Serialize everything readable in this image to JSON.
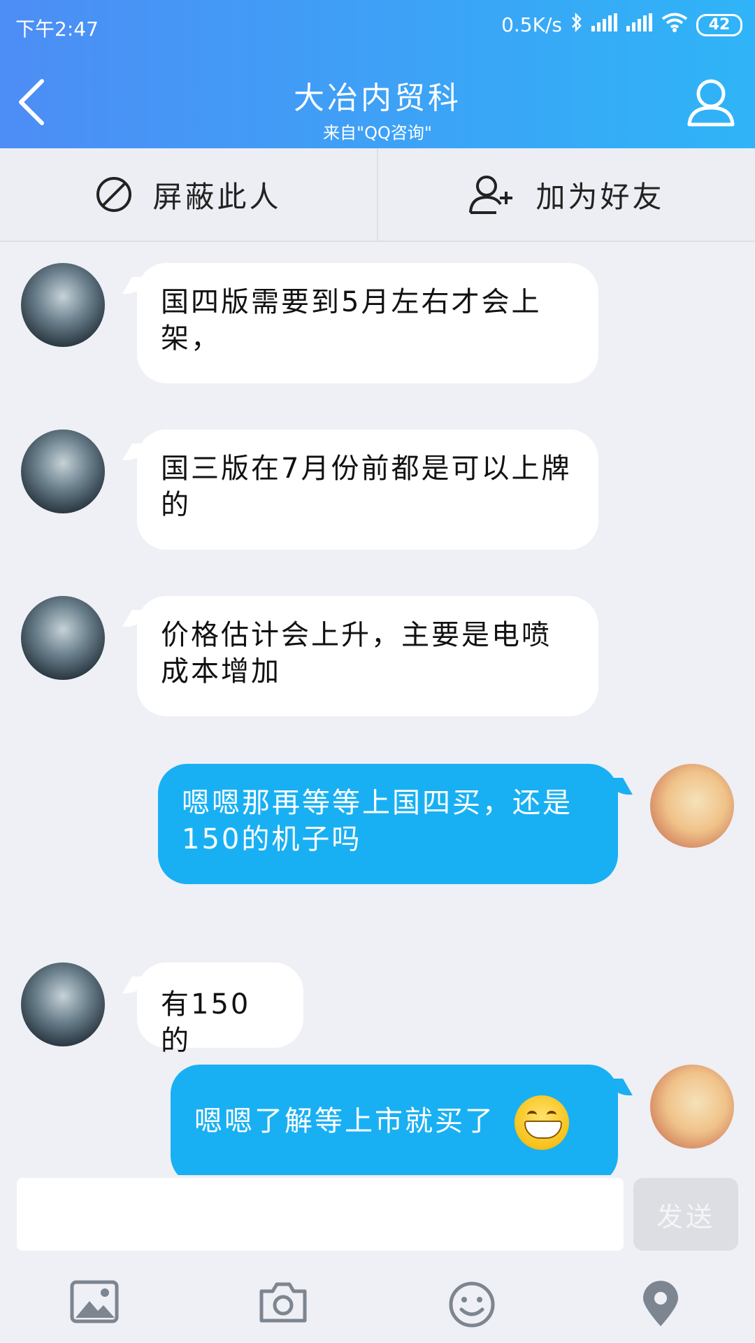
{
  "status_bar": {
    "time": "下午2:47",
    "net_speed": "0.5K/s",
    "battery": "42"
  },
  "header": {
    "title": "大冶内贸科",
    "subtitle": "来自\"QQ咨询\""
  },
  "actions": {
    "block_label": "屏蔽此人",
    "add_friend_label": "加为好友"
  },
  "messages": [
    {
      "sender": "them",
      "text": "国四版需要到5月左右才会上架，"
    },
    {
      "sender": "them",
      "text": "国三版在7月份前都是可以上牌的"
    },
    {
      "sender": "them",
      "text": "价格估计会上升，主要是电喷成本增加"
    },
    {
      "sender": "me",
      "text": "嗯嗯那再等等上国四买，还是150的机子吗"
    },
    {
      "sender": "them",
      "text": "有150的"
    },
    {
      "sender": "me",
      "text": "嗯嗯了解等上市就买了"
    }
  ],
  "input": {
    "value": "",
    "send_label": "发送"
  },
  "icons": {
    "back": "chevron-left-icon",
    "profile": "person-icon",
    "block": "block-icon",
    "add_friend": "add-friend-icon",
    "image": "image-icon",
    "camera": "camera-icon",
    "emoji": "emoji-icon",
    "location": "location-icon"
  },
  "colors": {
    "header_start": "#4d8df5",
    "header_end": "#2fb4f7",
    "my_bubble": "#19b0f3",
    "their_bubble": "#ffffff",
    "background": "#eef0f5"
  }
}
